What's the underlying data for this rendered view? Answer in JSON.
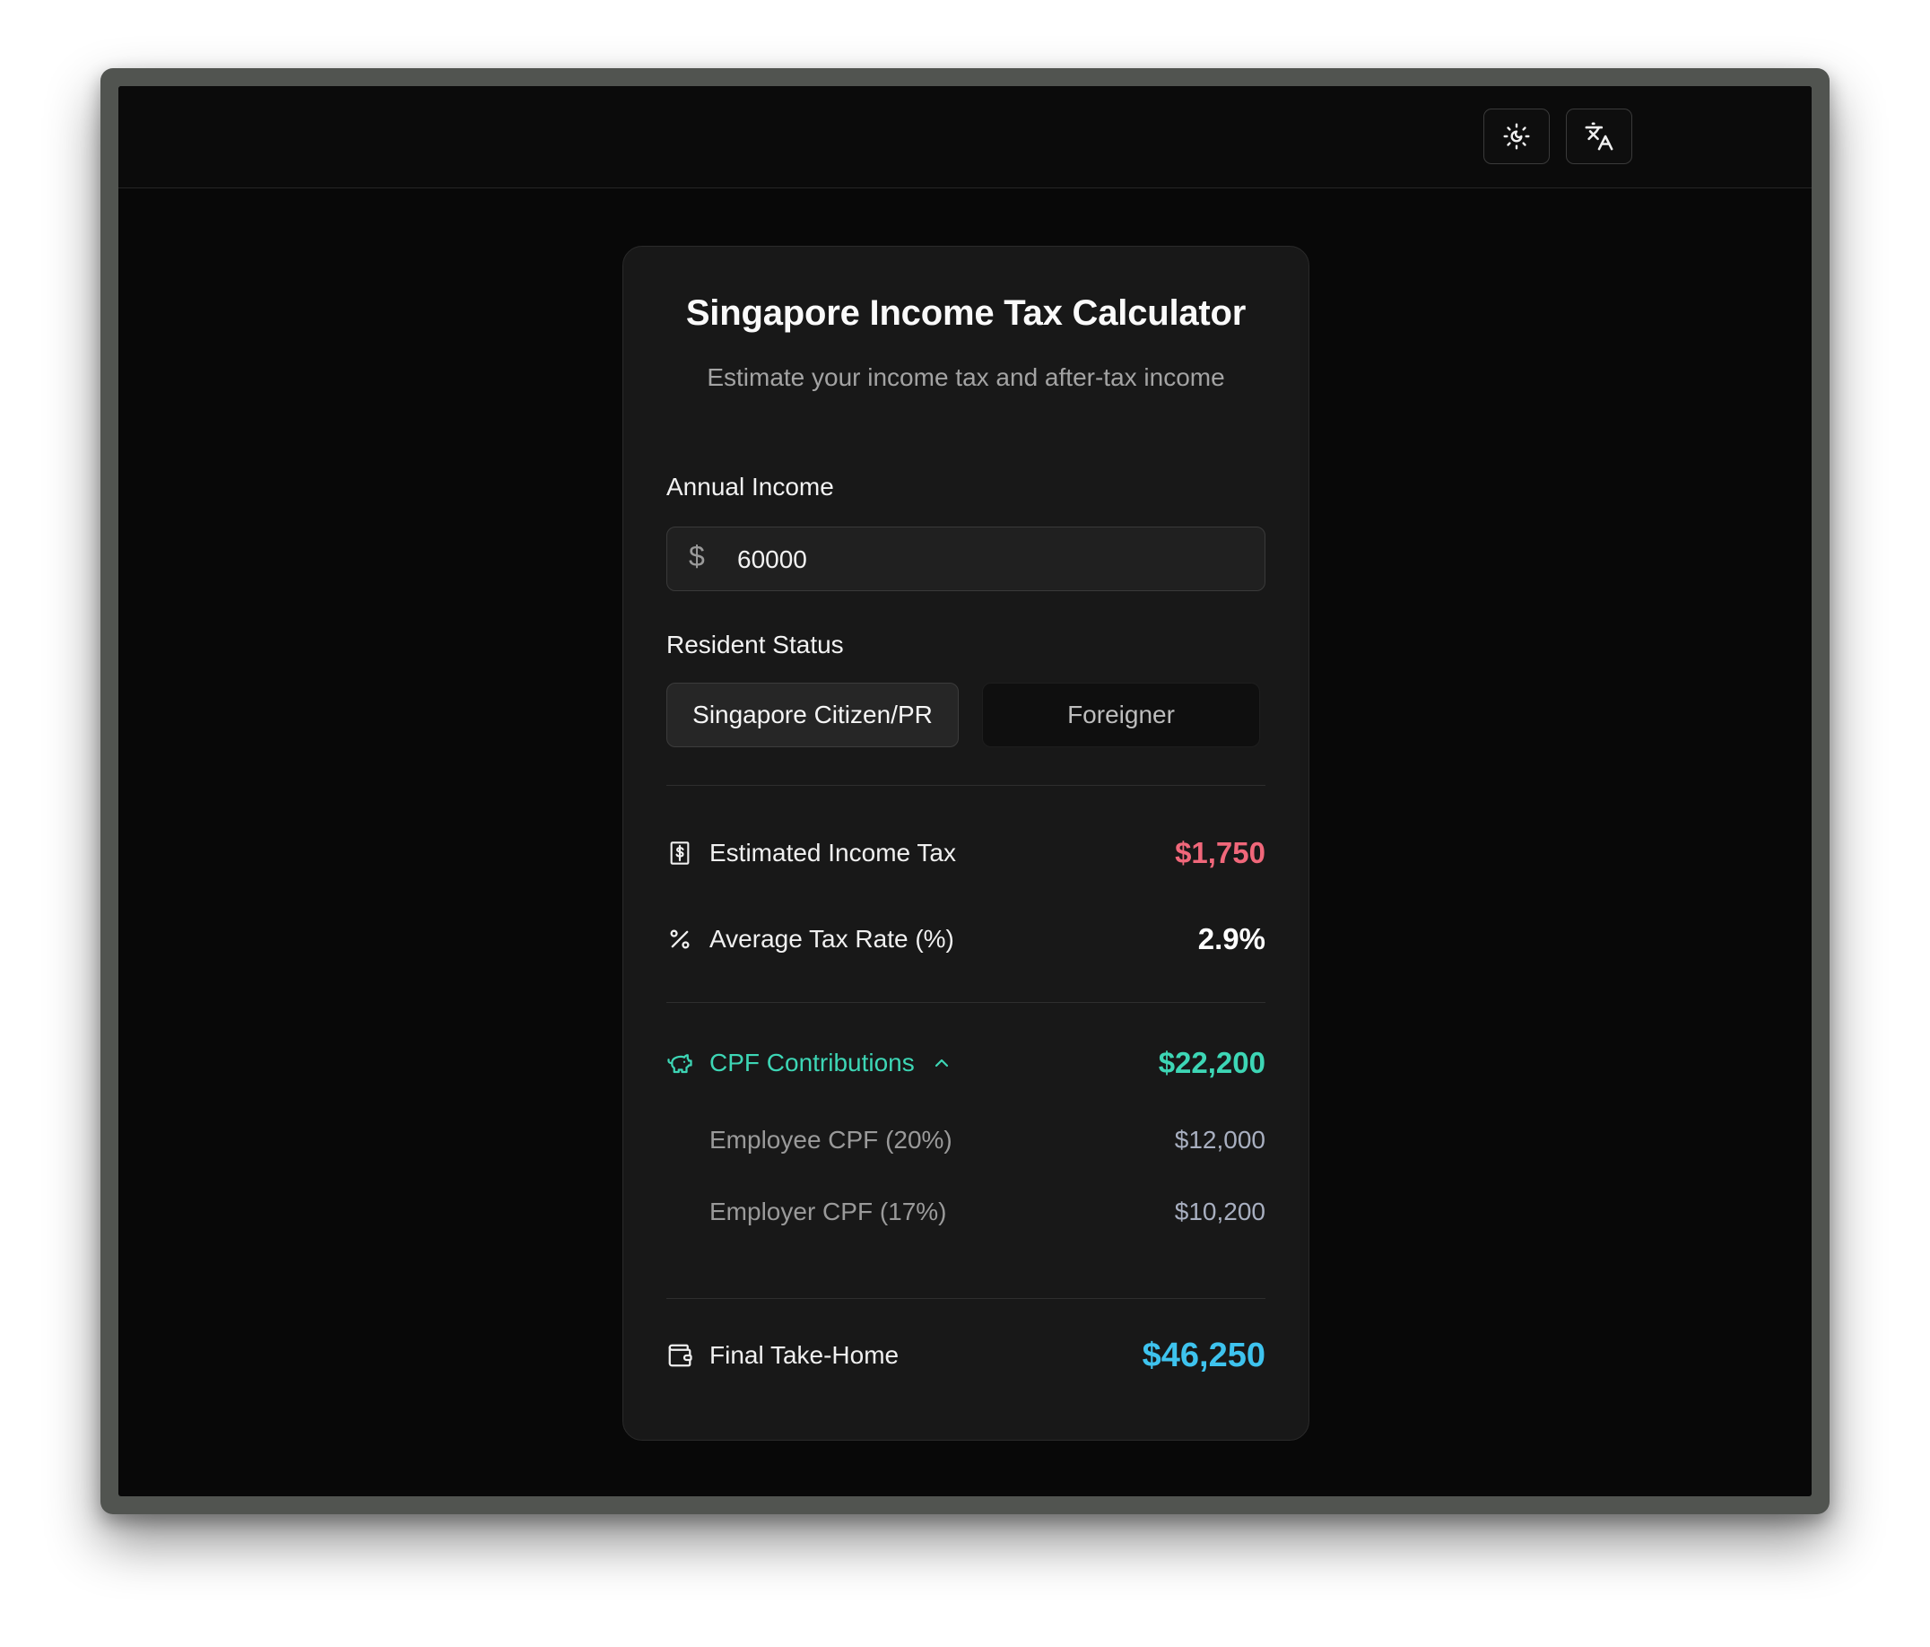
{
  "toolbar": {
    "theme_icon": "sun-moon-icon",
    "language_icon": "translate-icon"
  },
  "card": {
    "title": "Singapore Income Tax Calculator",
    "subtitle": "Estimate your income tax and after-tax income"
  },
  "income": {
    "label": "Annual Income",
    "currency_symbol": "$",
    "value": "60000"
  },
  "resident_status": {
    "label": "Resident Status",
    "options": [
      "Singapore Citizen/PR",
      "Foreigner"
    ],
    "selected": "Singapore Citizen/PR"
  },
  "results": {
    "tax": {
      "label": "Estimated Income Tax",
      "value": "$1,750",
      "icon": "receipt-dollar-icon",
      "color": "#f0677a"
    },
    "rate": {
      "label": "Average Tax Rate (%)",
      "value": "2.9%",
      "icon": "percent-icon",
      "color": "#ffffff"
    },
    "cpf": {
      "label": "CPF Contributions",
      "value": "$22,200",
      "icon": "piggy-bank-icon",
      "expanded": true,
      "color": "#3dd6b5",
      "items": [
        {
          "label": "Employee CPF (20%)",
          "value": "$12,000"
        },
        {
          "label": "Employer CPF (17%)",
          "value": "$10,200"
        }
      ]
    },
    "take_home": {
      "label": "Final Take-Home",
      "value": "$46,250",
      "icon": "wallet-icon",
      "color": "#3ec3ee"
    }
  }
}
